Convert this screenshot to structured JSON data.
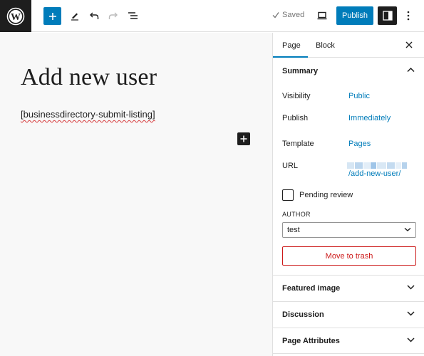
{
  "toolbar": {
    "logo": "wordpress-icon",
    "add_block_icon": "plus-icon",
    "tools_icon": "pencil-icon",
    "undo_icon": "undo-icon",
    "redo_icon": "redo-icon",
    "list_view_icon": "list-view-icon",
    "saved_label": "Saved",
    "view_icon": "desktop-icon",
    "publish_label": "Publish",
    "settings_icon": "sidebar-icon",
    "options_icon": "more-vertical-icon"
  },
  "editor": {
    "title": "Add new user",
    "shortcode": "[businessdirectory-submit-listing]"
  },
  "sidebar": {
    "tabs": [
      {
        "label": "Page",
        "active": true
      },
      {
        "label": "Block",
        "active": false
      }
    ],
    "summary": {
      "heading": "Summary",
      "visibility_label": "Visibility",
      "visibility_value": "Public",
      "publish_label": "Publish",
      "publish_value": "Immediately",
      "template_label": "Template",
      "template_value": "Pages",
      "url_label": "URL",
      "url_value": "/add-new-user/",
      "pending_label": "Pending review",
      "pending_checked": false,
      "author_label": "AUTHOR",
      "author_value": "test",
      "trash_label": "Move to trash"
    },
    "panels": [
      {
        "label": "Featured image"
      },
      {
        "label": "Discussion"
      },
      {
        "label": "Page Attributes"
      }
    ]
  },
  "colors": {
    "accent": "#007cba",
    "danger": "#cc1818",
    "dark": "#1e1e1e",
    "canvas_bg": "#f8f8f8"
  }
}
